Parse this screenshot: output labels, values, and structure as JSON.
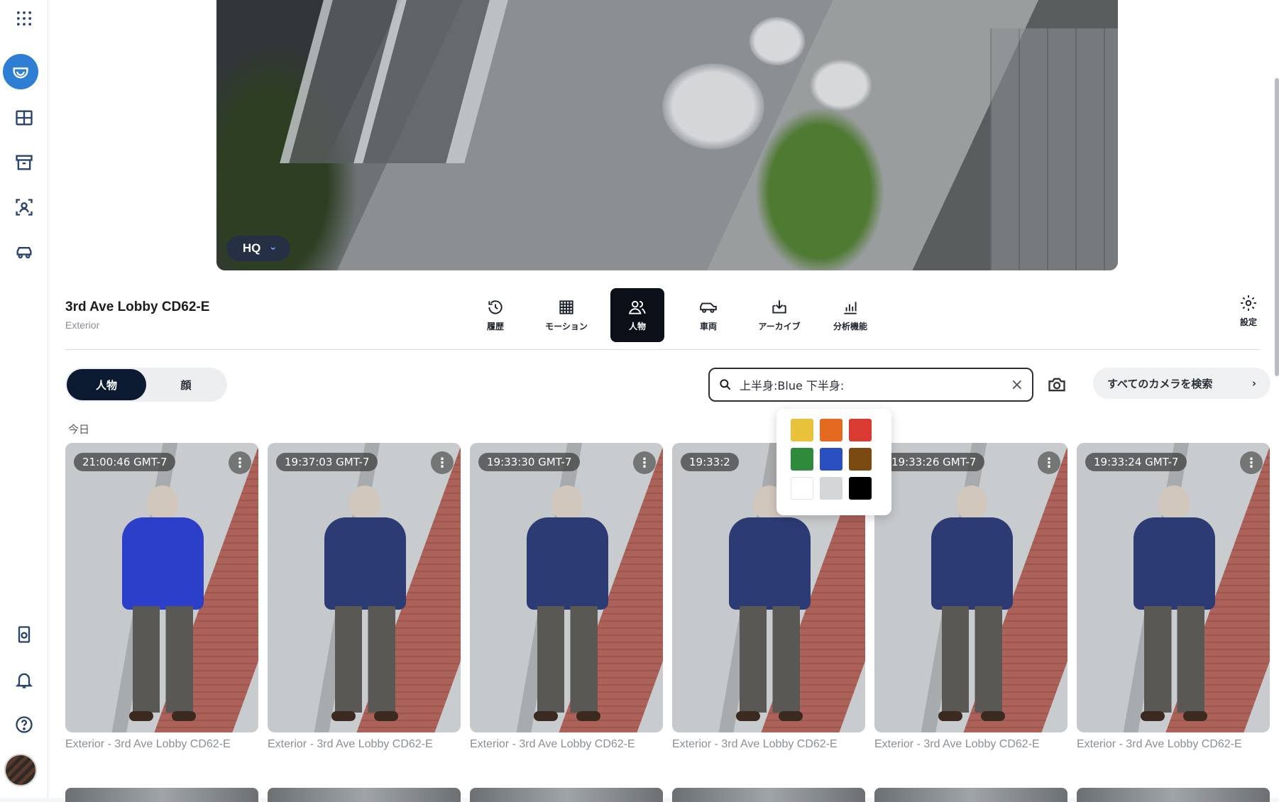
{
  "sidebar": {
    "items": [
      {
        "name": "apps-grid-icon"
      },
      {
        "name": "camera-dome-icon",
        "active": true
      },
      {
        "name": "layout-grid-icon"
      },
      {
        "name": "archive-box-icon"
      },
      {
        "name": "people-search-icon"
      },
      {
        "name": "vehicle-icon"
      },
      {
        "name": "device-icon"
      },
      {
        "name": "bell-icon"
      },
      {
        "name": "help-icon"
      }
    ]
  },
  "video": {
    "quality_label": "HQ"
  },
  "camera": {
    "title": "3rd Ave Lobby CD62-E",
    "subtitle": "Exterior"
  },
  "tabs": [
    {
      "label": "履歴",
      "icon": "history-icon"
    },
    {
      "label": "モーション",
      "icon": "motion-grid-icon"
    },
    {
      "label": "人物",
      "icon": "people-icon",
      "active": true
    },
    {
      "label": "車両",
      "icon": "vehicle-icon"
    },
    {
      "label": "アーカイブ",
      "icon": "archive-download-icon"
    },
    {
      "label": "分析機能",
      "icon": "bar-chart-icon"
    }
  ],
  "settings_label": "設定",
  "segment": {
    "options": [
      "人物",
      "顔"
    ],
    "selected": "人物"
  },
  "search": {
    "value": "上半身:Blue 下半身:"
  },
  "all_cameras_label": "すべてのカメラを検索",
  "section_label": "今日",
  "colors": {
    "accent": "#2e7fd3",
    "active_tab": "#0b0f18",
    "segment_on": "#0b1a30"
  },
  "palette": [
    "#e8c23a",
    "#e56a1f",
    "#d93a32",
    "#2f8a3c",
    "#2a4fc0",
    "#7a4a12",
    "#ffffff",
    "#d5d6d8",
    "#000000"
  ],
  "cards": [
    {
      "time": "21:00:46 GMT-7",
      "caption": "Exterior - 3rd Ave Lobby CD62-E"
    },
    {
      "time": "19:37:03 GMT-7",
      "caption": "Exterior - 3rd Ave Lobby CD62-E"
    },
    {
      "time": "19:33:30 GMT-7",
      "caption": "Exterior - 3rd Ave Lobby CD62-E"
    },
    {
      "time": "19:33:2",
      "caption": "Exterior - 3rd Ave Lobby CD62-E"
    },
    {
      "time": "19:33:26 GMT-7",
      "caption": "Exterior - 3rd Ave Lobby CD62-E"
    },
    {
      "time": "19:33:24 GMT-7",
      "caption": "Exterior - 3rd Ave Lobby CD62-E"
    }
  ]
}
